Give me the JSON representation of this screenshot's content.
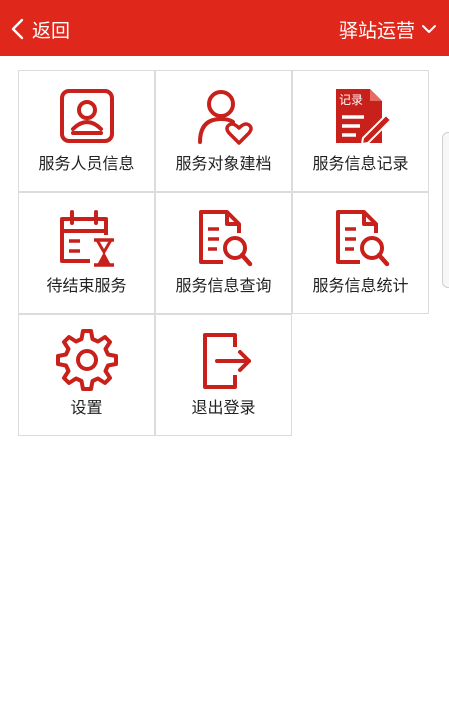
{
  "header": {
    "back_label": "返回",
    "title": "驿站运营"
  },
  "menu": [
    {
      "label": "服务人员信息",
      "icon": "staff-profile-icon"
    },
    {
      "label": "服务对象建档",
      "icon": "client-heart-icon"
    },
    {
      "label": "服务信息记录",
      "icon": "record-edit-icon"
    },
    {
      "label": "待结束服务",
      "icon": "calendar-hourglass-icon"
    },
    {
      "label": "服务信息查询",
      "icon": "document-search-icon"
    },
    {
      "label": "服务信息统计",
      "icon": "document-search-icon"
    },
    {
      "label": "设置",
      "icon": "gear-icon"
    },
    {
      "label": "退出登录",
      "icon": "logout-icon"
    }
  ],
  "record_icon_text": "记录",
  "colors": {
    "accent": "#e0271b",
    "icon": "#c8211b",
    "border": "#dcdcdc"
  }
}
